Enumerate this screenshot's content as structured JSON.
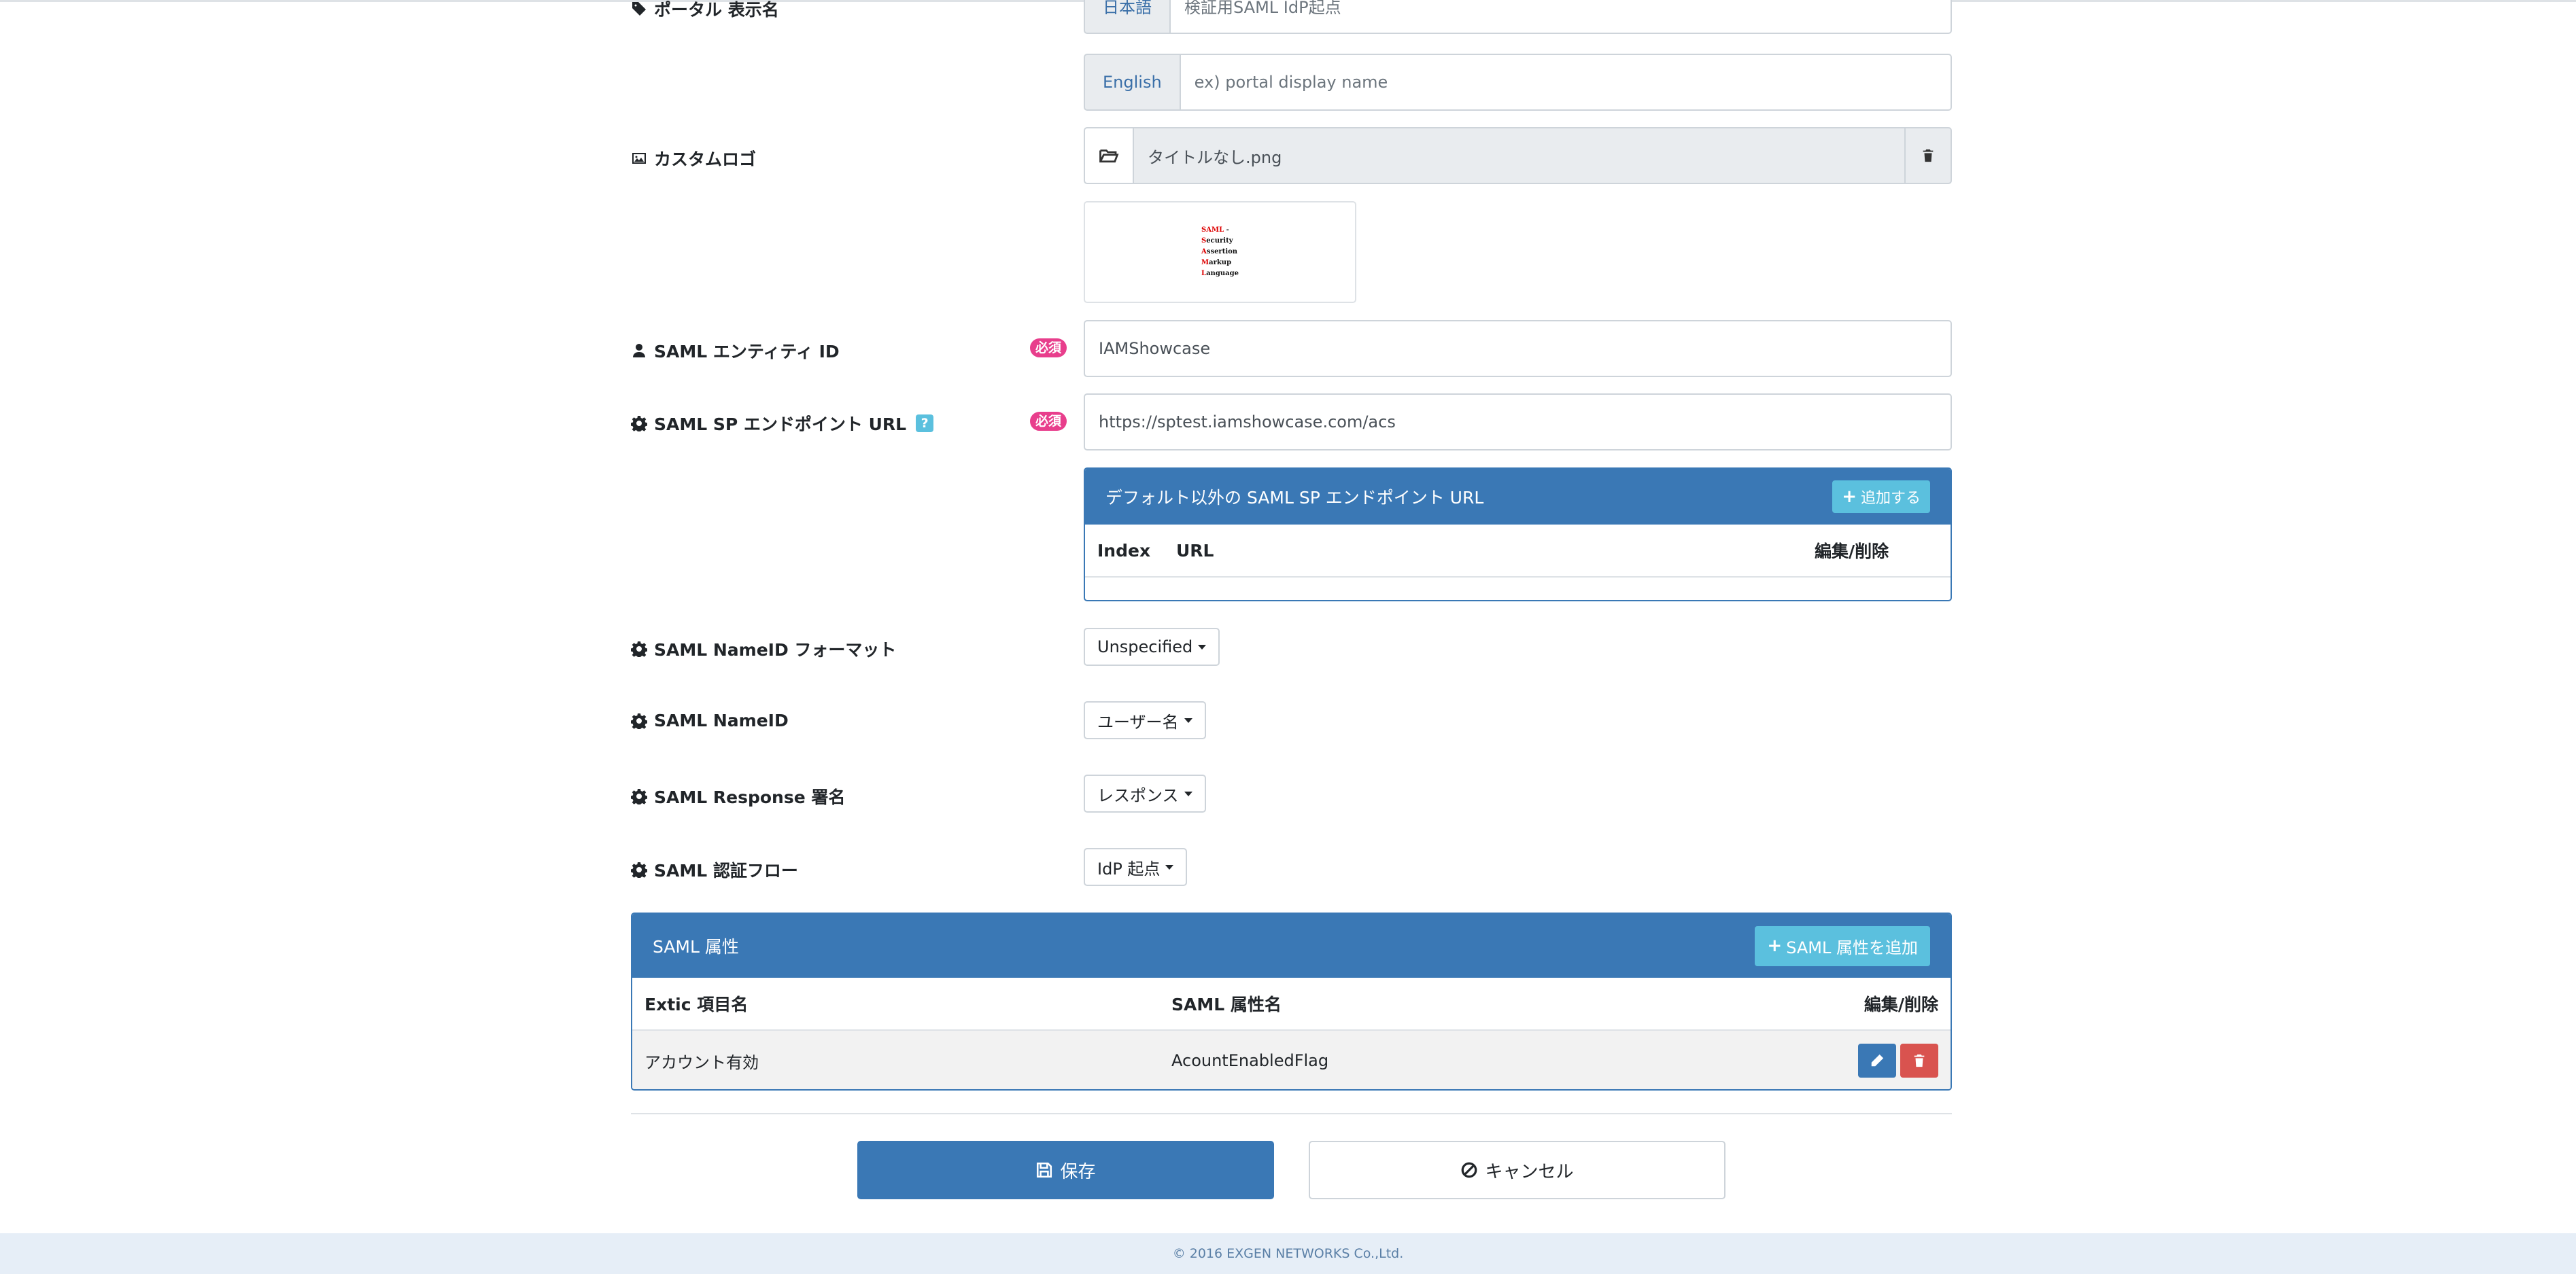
{
  "portal_display_name": {
    "label": "ポータル 表示名",
    "ja": {
      "addon": "日本語",
      "placeholder": "検証用SAML IdP起点"
    },
    "en": {
      "addon": "English",
      "placeholder": "ex) portal display name"
    }
  },
  "custom_logo": {
    "label": "カスタムロゴ",
    "file_name": "タイトルなし.png",
    "preview_lines": [
      {
        "initial": "SAML",
        "rest": " -"
      },
      {
        "initial": "S",
        "rest": "ecurity"
      },
      {
        "initial": "A",
        "rest": "ssertion"
      },
      {
        "initial": "M",
        "rest": "arkup"
      },
      {
        "initial": "L",
        "rest": "anguage"
      }
    ]
  },
  "required_badge": "必須",
  "entity_id": {
    "label": "SAML エンティティ ID",
    "value": "IAMShowcase"
  },
  "sp_endpoint": {
    "label": "SAML SP エンドポイント URL",
    "help": "?",
    "value": "https://sptest.iamshowcase.com/acs"
  },
  "extra_endpoints": {
    "title": "デフォルト以外の SAML SP エンドポイント URL",
    "add_button": "追加する",
    "columns": [
      "Index",
      "URL",
      "編集/削除"
    ]
  },
  "nameid_format": {
    "label": "SAML NameID フォーマット",
    "value": "Unspecified"
  },
  "nameid": {
    "label": "SAML NameID",
    "value": "ユーザー名"
  },
  "response_sign": {
    "label": "SAML Response 署名",
    "value": "レスポンス"
  },
  "auth_flow": {
    "label": "SAML 認証フロー",
    "value": "IdP 起点"
  },
  "attributes": {
    "title": "SAML 属性",
    "add_button": "SAML 属性を追加",
    "columns": [
      "Extic 項目名",
      "SAML 属性名",
      "編集/削除"
    ],
    "rows": [
      {
        "extic_name": "アカウント有効",
        "saml_name": "AcountEnabledFlag"
      }
    ]
  },
  "actions": {
    "save": "保存",
    "cancel": "キャンセル"
  },
  "footer": "© 2016 EXGEN NETWORKS Co.,Ltd."
}
